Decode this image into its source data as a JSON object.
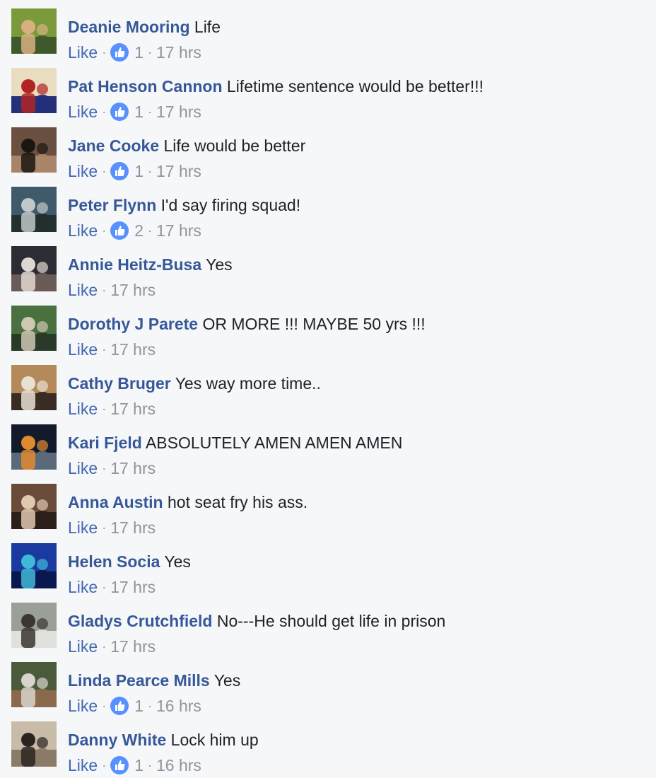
{
  "comments": [
    {
      "author": "Deanie Mooring",
      "text": "Life",
      "like_label": "Like",
      "reactions": "1",
      "time": "17 hrs",
      "avatar_colors": [
        "#7a9a3c",
        "#d8b080",
        "#3e5a2a"
      ]
    },
    {
      "author": "Pat Henson Cannon",
      "text": "Lifetime sentence would be better!!!",
      "like_label": "Like",
      "reactions": "1",
      "time": "17 hrs",
      "avatar_colors": [
        "#e8ddc0",
        "#b02424",
        "#24307a"
      ]
    },
    {
      "author": "Jane Cooke",
      "text": "Life would be better",
      "like_label": "Like",
      "reactions": "1",
      "time": "17 hrs",
      "avatar_colors": [
        "#6a5040",
        "#1c1610",
        "#a8856a"
      ]
    },
    {
      "author": "Peter Flynn",
      "text": "I'd say firing squad!",
      "like_label": "Like",
      "reactions": "2",
      "time": "17 hrs",
      "avatar_colors": [
        "#3f5a6a",
        "#c0c8c8",
        "#22302e"
      ]
    },
    {
      "author": "Annie Heitz-Busa",
      "text": "Yes",
      "like_label": "Like",
      "reactions": "",
      "time": "17 hrs",
      "avatar_colors": [
        "#2c2c34",
        "#e0d8d0",
        "#6a5a58"
      ]
    },
    {
      "author": "Dorothy J Parete",
      "text": "OR MORE !!! MAYBE 50 yrs !!!",
      "like_label": "Like",
      "reactions": "",
      "time": "17 hrs",
      "avatar_colors": [
        "#4a7040",
        "#cfc6b4",
        "#2a3a28"
      ]
    },
    {
      "author": "Cathy Bruger",
      "text": "Yes way more time..",
      "like_label": "Like",
      "reactions": "",
      "time": "17 hrs",
      "avatar_colors": [
        "#b48a5a",
        "#e8e0d4",
        "#3a2c24"
      ]
    },
    {
      "author": "Kari Fjeld",
      "text": "ABSOLUTELY AMEN AMEN AMEN",
      "like_label": "Like",
      "reactions": "",
      "time": "17 hrs",
      "avatar_colors": [
        "#121a2c",
        "#e08a30",
        "#5a6a7a"
      ]
    },
    {
      "author": "Anna Austin",
      "text": "hot seat fry his ass.",
      "like_label": "Like",
      "reactions": "",
      "time": "17 hrs",
      "avatar_colors": [
        "#6a4a38",
        "#e0c8b0",
        "#2c1e18"
      ]
    },
    {
      "author": "Helen Socia",
      "text": "Yes",
      "like_label": "Like",
      "reactions": "",
      "time": "17 hrs",
      "avatar_colors": [
        "#1a3aa0",
        "#40b8d8",
        "#0a1850"
      ]
    },
    {
      "author": "Gladys Crutchfield",
      "text": "No---He should get life in prison",
      "like_label": "Like",
      "reactions": "",
      "time": "17 hrs",
      "avatar_colors": [
        "#9aa098",
        "#3a3632",
        "#e0e0dc"
      ]
    },
    {
      "author": "Linda Pearce Mills",
      "text": "Yes",
      "like_label": "Like",
      "reactions": "1",
      "time": "16 hrs",
      "avatar_colors": [
        "#4a5a3a",
        "#d8d4cc",
        "#8a6a4a"
      ]
    },
    {
      "author": "Danny White",
      "text": "Lock him up",
      "like_label": "Like",
      "reactions": "1",
      "time": "16 hrs",
      "avatar_colors": [
        "#c8bca8",
        "#2a2420",
        "#8a7a68"
      ]
    }
  ],
  "separator": "·",
  "colors": {
    "author": "#365899",
    "link": "#4267b2",
    "meta": "#90949c",
    "like_badge": "#5890ff",
    "background": "#f6f7f9"
  }
}
